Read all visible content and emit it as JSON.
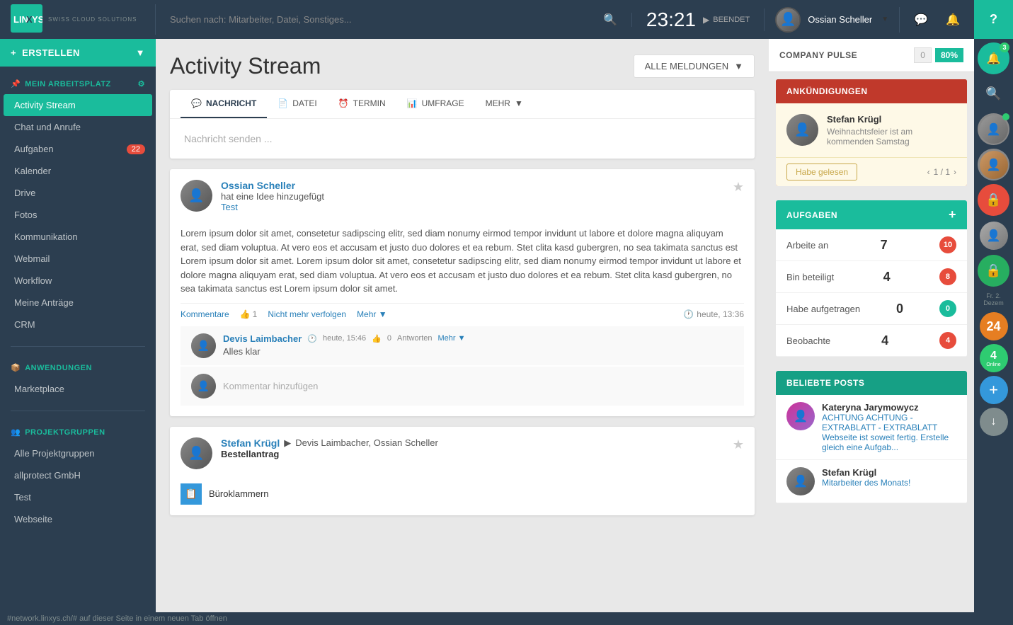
{
  "topnav": {
    "logo": "LINXYS",
    "logo_sub": "SWISS CLOUD SOLUTIONS",
    "search_placeholder": "Suchen nach: Mitarbeiter, Datei, Sonstiges...",
    "time": "23:21",
    "time_status": "BEENDET",
    "user_name": "Ossian Scheller",
    "help_label": "?"
  },
  "sidebar": {
    "create_label": "ERSTELLEN",
    "my_workspace_label": "MEIN ARBEITSPLATZ",
    "items": [
      {
        "id": "activity-stream",
        "label": "Activity Stream",
        "active": true,
        "badge": null
      },
      {
        "id": "chat",
        "label": "Chat und Anrufe",
        "active": false,
        "badge": null
      },
      {
        "id": "aufgaben",
        "label": "Aufgaben",
        "active": false,
        "badge": "22"
      },
      {
        "id": "kalender",
        "label": "Kalender",
        "active": false,
        "badge": null
      },
      {
        "id": "drive",
        "label": "Drive",
        "active": false,
        "badge": null
      },
      {
        "id": "fotos",
        "label": "Fotos",
        "active": false,
        "badge": null
      },
      {
        "id": "kommunikation",
        "label": "Kommunikation",
        "active": false,
        "badge": null
      },
      {
        "id": "webmail",
        "label": "Webmail",
        "active": false,
        "badge": null
      },
      {
        "id": "workflow",
        "label": "Workflow",
        "active": false,
        "badge": null
      },
      {
        "id": "antraege",
        "label": "Meine Anträge",
        "active": false,
        "badge": null
      },
      {
        "id": "crm",
        "label": "CRM",
        "active": false,
        "badge": null
      }
    ],
    "anwendungen_label": "ANWENDUNGEN",
    "anwendungen_items": [
      {
        "id": "marketplace",
        "label": "Marketplace",
        "badge": null
      }
    ],
    "projektgruppen_label": "PROJEKTGRUPPEN",
    "projektgruppen_items": [
      {
        "id": "alle",
        "label": "Alle Projektgruppen"
      },
      {
        "id": "allprotect",
        "label": "allprotect GmbH"
      },
      {
        "id": "test",
        "label": "Test"
      },
      {
        "id": "webseite",
        "label": "Webseite"
      }
    ]
  },
  "main": {
    "title": "Activity Stream",
    "filter_label": "ALLE MELDUNGEN",
    "composer": {
      "tabs": [
        {
          "id": "nachricht",
          "label": "NACHRICHT",
          "active": true
        },
        {
          "id": "datei",
          "label": "DATEI",
          "active": false
        },
        {
          "id": "termin",
          "label": "TERMIN",
          "active": false
        },
        {
          "id": "umfrage",
          "label": "UMFRAGE",
          "active": false
        },
        {
          "id": "mehr",
          "label": "MEHR",
          "active": false
        }
      ],
      "placeholder": "Nachricht senden ..."
    },
    "posts": [
      {
        "id": "post1",
        "author": "Ossian Scheller",
        "action": "hat eine Idee hinzugefügt",
        "link_text": "Test",
        "body": "Lorem ipsum dolor sit amet, consetetur sadipscing elitr, sed diam nonumy eirmod tempor invidunt ut labore et dolore magna aliquyam erat, sed diam voluptua. At vero eos et accusam et justo duo dolores et ea rebum. Stet clita kasd gubergren, no sea takimata sanctus est Lorem ipsum dolor sit amet. Lorem ipsum dolor sit amet, consetetur sadipscing elitr, sed diam nonumy eirmod tempor invidunt ut labore et dolore magna aliquyam erat, sed diam voluptua. At vero eos et accusam et justo duo dolores et ea rebum. Stet clita kasd gubergren, no sea takimata sanctus est Lorem ipsum dolor sit amet.",
        "time": "heute, 13:36",
        "likes": "1",
        "comments_label": "Kommentare",
        "unfollow_label": "Nicht mehr verfolgen",
        "more_label": "Mehr",
        "comments": [
          {
            "author": "Devis Laimbacher",
            "time": "heute, 15:46",
            "likes": "0",
            "reply_label": "Antworten",
            "more_label": "Mehr",
            "body": "Alles klar"
          }
        ],
        "add_comment_placeholder": "Kommentar hinzufügen"
      },
      {
        "id": "post2",
        "author": "Stefan Krügl",
        "recipients": "Devis Laimbacher, Ossian Scheller",
        "action": "Bestellantrag",
        "link_text": "",
        "body": "Büroklammern",
        "time": "",
        "likes": "",
        "comments_label": "",
        "unfollow_label": "",
        "more_label": "",
        "comments": []
      }
    ]
  },
  "right_sidebar": {
    "pulse_title": "COMPANY PULSE",
    "pulse_zero": "0",
    "pulse_percent": "80%",
    "announcements": {
      "header": "ANKÜNDIGUNGEN",
      "item": {
        "author": "Stefan Krügl",
        "text": "Weihnachtsfeier ist am kommenden Samstag"
      },
      "read_label": "Habe gelesen",
      "nav": "1 / 1"
    },
    "aufgaben": {
      "header": "AUFGABEN",
      "rows": [
        {
          "label": "Arbeite an",
          "count": "7",
          "badge": "10",
          "badge_color": "red"
        },
        {
          "label": "Bin beteiligt",
          "count": "4",
          "badge": "8",
          "badge_color": "red"
        },
        {
          "label": "Habe aufgetragen",
          "count": "0",
          "badge": "0",
          "badge_color": "teal"
        },
        {
          "label": "Beobachte",
          "count": "4",
          "badge": "4",
          "badge_color": "red"
        }
      ]
    },
    "beliebte_posts": {
      "header": "BELIEBTE POSTS",
      "items": [
        {
          "author": "Kateryna Jarymowycz",
          "text": "ACHTUNG ACHTUNG - EXTRABLATT - EXTRABLATT Webseite ist soweit fertig. Erstelle gleich eine Aufgab..."
        },
        {
          "author": "Stefan Krügl",
          "text": "Mitarbeiter des Monats!"
        }
      ]
    }
  },
  "far_right": {
    "online_count": "4",
    "date_label": "Fr. 2. Dezem",
    "day_number": "24",
    "add_label": "+",
    "download_label": "↓"
  },
  "bottombar": {
    "text": "#network.linxys.ch/# auf dieser Seite in einem neuen Tab öffnen"
  }
}
